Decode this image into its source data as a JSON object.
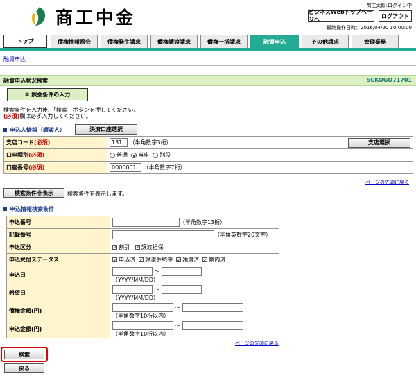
{
  "header": {
    "logo_text": "商工中金",
    "user_status": "商工太郎:ログイン中",
    "top_page_button": "ビジネスWebトップページへ",
    "logout_button": "ログアウト",
    "last_operation": "最終操作日時：2016/04/20 10:00:00"
  },
  "tabs": [
    "トップ",
    "債権情報照会",
    "債権発生請求",
    "債権譲渡請求",
    "債権一括請求",
    "融資申込",
    "その他請求",
    "管理業務"
  ],
  "breadcrumb": "融資申込",
  "page": {
    "title": "融資申込状況検索",
    "screen_id": "SCKOGO71701",
    "step_label": "① 照会条件の入力",
    "instruction1": "検索条件を入力後、「検索」ボタンを押してください。",
    "instruction2_req": "(必須)",
    "instruction2_rest": "欄は必ず入力してください。"
  },
  "applicant": {
    "section_title": "申込人情報（譲渡人）",
    "account_select_button": "決済口座選択",
    "branch_code_label": "支店コード",
    "required_mark": "(必須)",
    "branch_code_value": "131",
    "branch_code_hint": "（半角数字3桁）",
    "branch_select_button": "支店選択",
    "account_type_label": "口座種別",
    "account_type_options": [
      "普通",
      "当座",
      "別段"
    ],
    "account_type_selected": "当座",
    "account_number_label": "口座番号",
    "account_number_value": "0000001",
    "account_number_hint": "（半角数字7桁）",
    "page_top_link": "ページの先頭に戻る"
  },
  "toggle": {
    "button": "検索条件非表示",
    "note": "検索条件を表示します。"
  },
  "search": {
    "section_title": "申込情報検索条件",
    "app_number_label": "申込番号",
    "app_number_hint": "（半角数字13桁）",
    "record_number_label": "記録番号",
    "record_number_hint": "（半角英数字20文字）",
    "app_type_label": "申込区分",
    "app_type_options": [
      "割引",
      "譲渡担保"
    ],
    "status_label": "申込受付ステータス",
    "status_options": [
      "申込済",
      "譲渡手続中",
      "譲渡済",
      "案内済"
    ],
    "app_date_label": "申込日",
    "date_hint": "（YYYY/MM/DD）",
    "desired_date_label": "希望日",
    "claim_amount_label": "債権金額(円)",
    "amount_hint": "（半角数字10桁以内）",
    "app_amount_label": "申込金額(円)",
    "tilde": "～",
    "page_top_link": "ページの先頭に戻る"
  },
  "actions": {
    "search_button": "検索",
    "back_button": "戻る"
  },
  "colors": {
    "accent_teal": "#23ab94",
    "title_bar": "#ddf0c4",
    "label_bg": "#fff4cc",
    "highlight_red": "#e00000"
  }
}
